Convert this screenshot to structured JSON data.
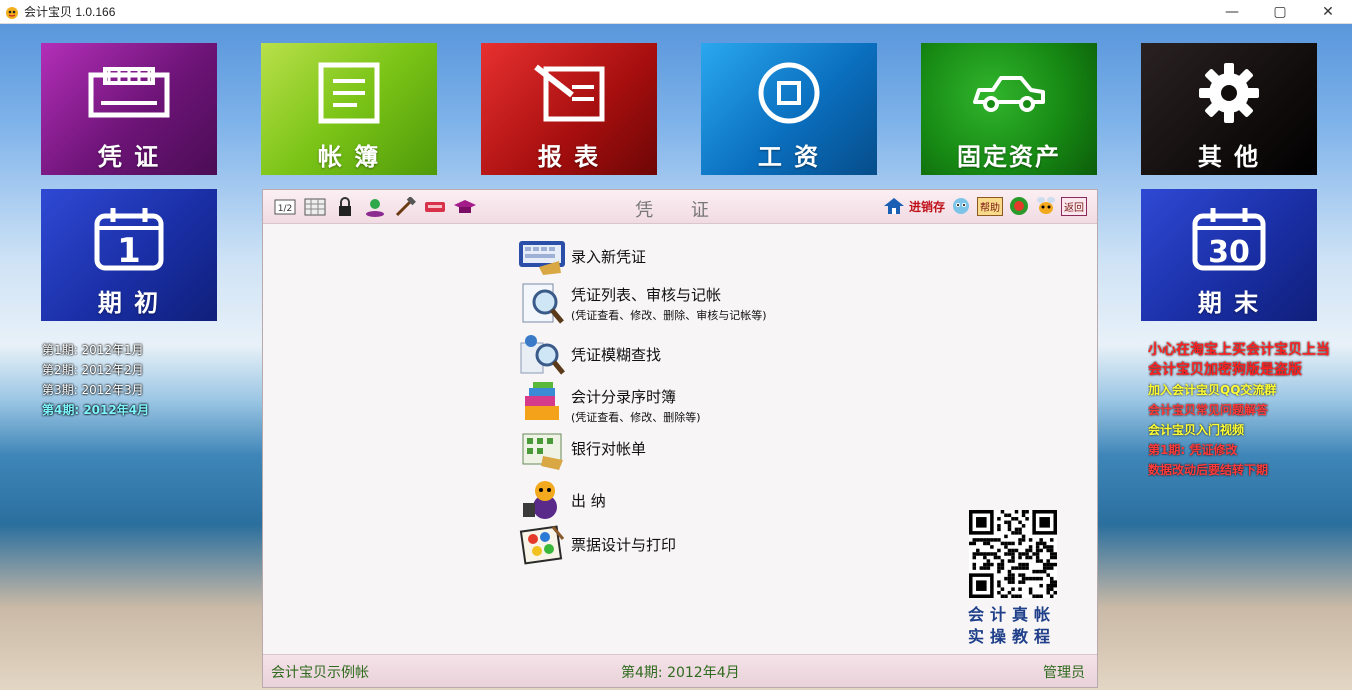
{
  "window": {
    "title": "会计宝贝 1.0.166",
    "controls": [
      "—",
      "▢",
      "✕"
    ]
  },
  "tiles": {
    "voucher": "凭 证",
    "ledger": "帐 簿",
    "report": "报 表",
    "salary": "工 资",
    "fixed_assets": "固定资产",
    "other": "其 他",
    "period_start": {
      "label": "期 初",
      "day": "1"
    },
    "period_end": {
      "label": "期 末",
      "day": "30"
    }
  },
  "periods": [
    "第1期: 2012年1月",
    "第2期: 2012年2月",
    "第3期: 2012年3月",
    "第4期: 2012年4月"
  ],
  "notices": {
    "warning1": "小心在淘宝上买会计宝贝上当",
    "warning2": "会计宝贝加密狗版是盗版",
    "qq_group": "加入会计宝贝QQ交流群",
    "faq": "会计宝贝常见问题解答",
    "video": "会计宝贝入门视频",
    "edit_period": "第1期: 凭证修改",
    "carry_forward": "数据改动后要结转下期"
  },
  "panel": {
    "title": "凭 证",
    "toolbar_right": {
      "inventory": "进销存",
      "help": "帮助",
      "exit": "返回"
    },
    "menu": [
      {
        "label": "录入新凭证",
        "sub": ""
      },
      {
        "label": "凭证列表、审核与记帐",
        "sub": "(凭证查看、修改、删除、审核与记帐等)"
      },
      {
        "label": "凭证模糊查找",
        "sub": ""
      },
      {
        "label": "会计分录序时簿",
        "sub": "(凭证查看、修改、删除等)"
      },
      {
        "label": "银行对帐单",
        "sub": ""
      },
      {
        "label": "出 纳",
        "sub": ""
      },
      {
        "label": "票据设计与打印",
        "sub": ""
      }
    ],
    "qr_caption_1": "会计真帐",
    "qr_caption_2": "实操教程",
    "footer": {
      "account": "会计宝贝示例帐",
      "period": "第4期: 2012年4月",
      "user": "管理员"
    }
  },
  "colors": {
    "accent_red": "#c0121a",
    "footer_green": "#2f6b1e",
    "active_period": "#7ff6ff"
  }
}
